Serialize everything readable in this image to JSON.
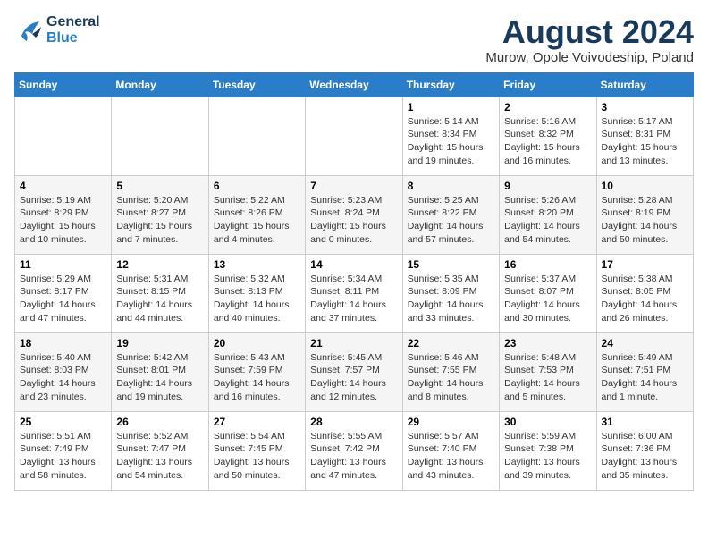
{
  "header": {
    "logo_line1": "General",
    "logo_line2": "Blue",
    "month": "August 2024",
    "location": "Murow, Opole Voivodeship, Poland"
  },
  "weekdays": [
    "Sunday",
    "Monday",
    "Tuesday",
    "Wednesday",
    "Thursday",
    "Friday",
    "Saturday"
  ],
  "weeks": [
    [
      {
        "day": "",
        "info": ""
      },
      {
        "day": "",
        "info": ""
      },
      {
        "day": "",
        "info": ""
      },
      {
        "day": "",
        "info": ""
      },
      {
        "day": "1",
        "info": "Sunrise: 5:14 AM\nSunset: 8:34 PM\nDaylight: 15 hours\nand 19 minutes."
      },
      {
        "day": "2",
        "info": "Sunrise: 5:16 AM\nSunset: 8:32 PM\nDaylight: 15 hours\nand 16 minutes."
      },
      {
        "day": "3",
        "info": "Sunrise: 5:17 AM\nSunset: 8:31 PM\nDaylight: 15 hours\nand 13 minutes."
      }
    ],
    [
      {
        "day": "4",
        "info": "Sunrise: 5:19 AM\nSunset: 8:29 PM\nDaylight: 15 hours\nand 10 minutes."
      },
      {
        "day": "5",
        "info": "Sunrise: 5:20 AM\nSunset: 8:27 PM\nDaylight: 15 hours\nand 7 minutes."
      },
      {
        "day": "6",
        "info": "Sunrise: 5:22 AM\nSunset: 8:26 PM\nDaylight: 15 hours\nand 4 minutes."
      },
      {
        "day": "7",
        "info": "Sunrise: 5:23 AM\nSunset: 8:24 PM\nDaylight: 15 hours\nand 0 minutes."
      },
      {
        "day": "8",
        "info": "Sunrise: 5:25 AM\nSunset: 8:22 PM\nDaylight: 14 hours\nand 57 minutes."
      },
      {
        "day": "9",
        "info": "Sunrise: 5:26 AM\nSunset: 8:20 PM\nDaylight: 14 hours\nand 54 minutes."
      },
      {
        "day": "10",
        "info": "Sunrise: 5:28 AM\nSunset: 8:19 PM\nDaylight: 14 hours\nand 50 minutes."
      }
    ],
    [
      {
        "day": "11",
        "info": "Sunrise: 5:29 AM\nSunset: 8:17 PM\nDaylight: 14 hours\nand 47 minutes."
      },
      {
        "day": "12",
        "info": "Sunrise: 5:31 AM\nSunset: 8:15 PM\nDaylight: 14 hours\nand 44 minutes."
      },
      {
        "day": "13",
        "info": "Sunrise: 5:32 AM\nSunset: 8:13 PM\nDaylight: 14 hours\nand 40 minutes."
      },
      {
        "day": "14",
        "info": "Sunrise: 5:34 AM\nSunset: 8:11 PM\nDaylight: 14 hours\nand 37 minutes."
      },
      {
        "day": "15",
        "info": "Sunrise: 5:35 AM\nSunset: 8:09 PM\nDaylight: 14 hours\nand 33 minutes."
      },
      {
        "day": "16",
        "info": "Sunrise: 5:37 AM\nSunset: 8:07 PM\nDaylight: 14 hours\nand 30 minutes."
      },
      {
        "day": "17",
        "info": "Sunrise: 5:38 AM\nSunset: 8:05 PM\nDaylight: 14 hours\nand 26 minutes."
      }
    ],
    [
      {
        "day": "18",
        "info": "Sunrise: 5:40 AM\nSunset: 8:03 PM\nDaylight: 14 hours\nand 23 minutes."
      },
      {
        "day": "19",
        "info": "Sunrise: 5:42 AM\nSunset: 8:01 PM\nDaylight: 14 hours\nand 19 minutes."
      },
      {
        "day": "20",
        "info": "Sunrise: 5:43 AM\nSunset: 7:59 PM\nDaylight: 14 hours\nand 16 minutes."
      },
      {
        "day": "21",
        "info": "Sunrise: 5:45 AM\nSunset: 7:57 PM\nDaylight: 14 hours\nand 12 minutes."
      },
      {
        "day": "22",
        "info": "Sunrise: 5:46 AM\nSunset: 7:55 PM\nDaylight: 14 hours\nand 8 minutes."
      },
      {
        "day": "23",
        "info": "Sunrise: 5:48 AM\nSunset: 7:53 PM\nDaylight: 14 hours\nand 5 minutes."
      },
      {
        "day": "24",
        "info": "Sunrise: 5:49 AM\nSunset: 7:51 PM\nDaylight: 14 hours\nand 1 minute."
      }
    ],
    [
      {
        "day": "25",
        "info": "Sunrise: 5:51 AM\nSunset: 7:49 PM\nDaylight: 13 hours\nand 58 minutes."
      },
      {
        "day": "26",
        "info": "Sunrise: 5:52 AM\nSunset: 7:47 PM\nDaylight: 13 hours\nand 54 minutes."
      },
      {
        "day": "27",
        "info": "Sunrise: 5:54 AM\nSunset: 7:45 PM\nDaylight: 13 hours\nand 50 minutes."
      },
      {
        "day": "28",
        "info": "Sunrise: 5:55 AM\nSunset: 7:42 PM\nDaylight: 13 hours\nand 47 minutes."
      },
      {
        "day": "29",
        "info": "Sunrise: 5:57 AM\nSunset: 7:40 PM\nDaylight: 13 hours\nand 43 minutes."
      },
      {
        "day": "30",
        "info": "Sunrise: 5:59 AM\nSunset: 7:38 PM\nDaylight: 13 hours\nand 39 minutes."
      },
      {
        "day": "31",
        "info": "Sunrise: 6:00 AM\nSunset: 7:36 PM\nDaylight: 13 hours\nand 35 minutes."
      }
    ]
  ]
}
